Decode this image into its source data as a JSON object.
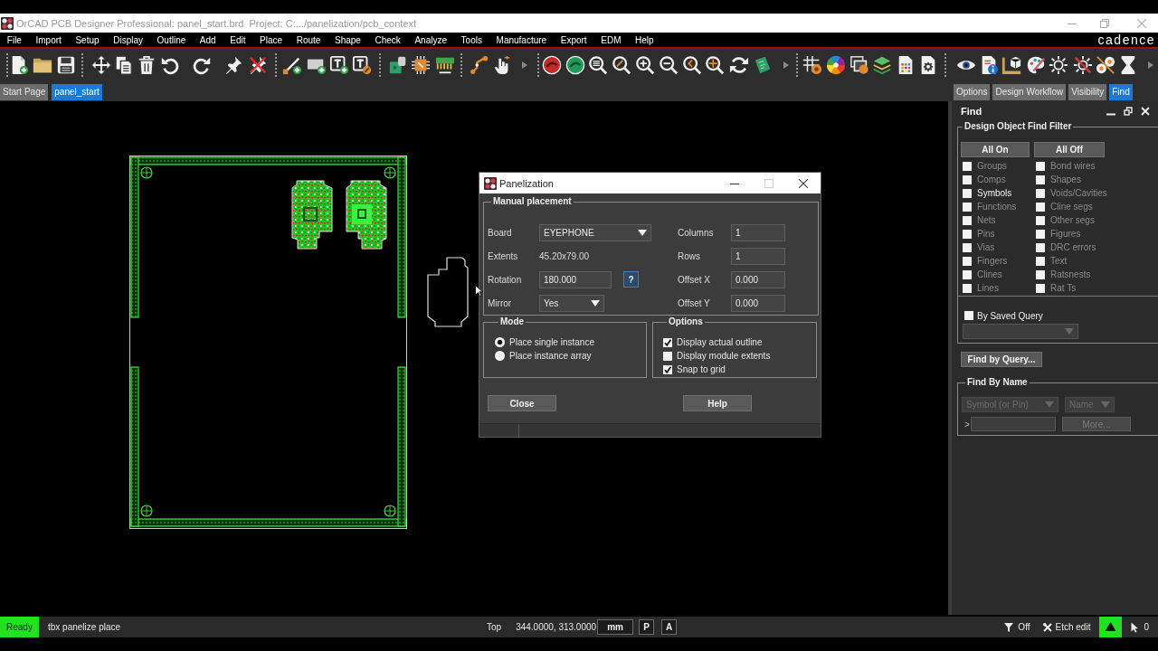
{
  "window": {
    "title": "OrCAD PCB Designer Professional: panel_start.brd  Project: C:.../panelization/pcb_context"
  },
  "menu_bar": {
    "items": [
      "File",
      "Import",
      "Setup",
      "Display",
      "Outline",
      "Add",
      "Edit",
      "Place",
      "Route",
      "Shape",
      "Check",
      "Analyze",
      "Tools",
      "Manufacture",
      "Export",
      "EDM",
      "Help"
    ],
    "logo": "cadence"
  },
  "document_tabs": [
    {
      "label": "Start Page",
      "selected": false
    },
    {
      "label": "panel_start",
      "selected": true
    }
  ],
  "panel_tabs": [
    {
      "label": "Options",
      "selected": false
    },
    {
      "label": "Design Workflow",
      "selected": false
    },
    {
      "label": "Visibility",
      "selected": false
    },
    {
      "label": "Find",
      "selected": true
    }
  ],
  "panelization_dialog": {
    "title": "Panelization",
    "manual_placement": {
      "title": "Manual placement",
      "rows": [
        {
          "left": {
            "label": "Board",
            "kind": "dropdown",
            "value": "EYEPHONE"
          },
          "right": {
            "label": "Columns",
            "kind": "input",
            "value": "1"
          }
        },
        {
          "left": {
            "label": "Extents",
            "kind": "readout",
            "value": "45.20x79.00"
          },
          "right": {
            "label": "Rows",
            "kind": "input",
            "value": "1"
          }
        },
        {
          "left": {
            "label": "Rotation",
            "kind": "input",
            "value": "180.000",
            "help_button": "?"
          },
          "right": {
            "label": "Offset X",
            "kind": "input",
            "value": "0.000"
          }
        },
        {
          "left": {
            "label": "Mirror",
            "kind": "dropdown",
            "value": "Yes"
          },
          "right": {
            "label": "Offset Y",
            "kind": "input",
            "value": "0.000"
          }
        }
      ]
    },
    "mode": {
      "title": "Mode",
      "options": [
        {
          "label": "Place single instance",
          "selected": true
        },
        {
          "label": "Place instance array",
          "selected": false
        }
      ]
    },
    "options": {
      "title": "Options",
      "items": [
        {
          "label": "Display actual outline",
          "checked": true
        },
        {
          "label": "Display module extents",
          "checked": false
        },
        {
          "label": "Snap to grid",
          "checked": true
        }
      ]
    },
    "buttons": [
      "Close",
      "Help"
    ]
  },
  "find_panel": {
    "title": "Find",
    "filter": {
      "title": "Design Object Find Filter",
      "buttons": [
        "All On",
        "All Off"
      ],
      "columns": [
        {
          "items": [
            {
              "label": "Groups",
              "checked": false,
              "disabled": true
            },
            {
              "label": "Comps",
              "checked": false,
              "disabled": true
            },
            {
              "label": "Symbols",
              "checked": false,
              "disabled": false
            },
            {
              "label": "Functions",
              "checked": false,
              "disabled": true
            },
            {
              "label": "Nets",
              "checked": false,
              "disabled": true
            },
            {
              "label": "Pins",
              "checked": false,
              "disabled": true
            },
            {
              "label": "Vias",
              "checked": false,
              "disabled": true
            },
            {
              "label": "Fingers",
              "checked": false,
              "disabled": true
            },
            {
              "label": "Clines",
              "checked": false,
              "disabled": true
            },
            {
              "label": "Lines",
              "checked": false,
              "disabled": true
            }
          ]
        },
        {
          "items": [
            {
              "label": "Bond wires",
              "checked": false,
              "disabled": true
            },
            {
              "label": "Shapes",
              "checked": false,
              "disabled": true
            },
            {
              "label": "Voids/Cavities",
              "checked": false,
              "disabled": true
            },
            {
              "label": "Cline segs",
              "checked": false,
              "disabled": true
            },
            {
              "label": "Other segs",
              "checked": false,
              "disabled": true
            },
            {
              "label": "Figures",
              "checked": false,
              "disabled": true
            },
            {
              "label": "DRC errors",
              "checked": false,
              "disabled": true
            },
            {
              "label": "Text",
              "checked": false,
              "disabled": true
            },
            {
              "label": "Ratsnests",
              "checked": false,
              "disabled": true
            },
            {
              "label": "Rat Ts",
              "checked": false,
              "disabled": true
            }
          ]
        }
      ],
      "saved_query": {
        "label": "By Saved Query",
        "checked": false
      }
    },
    "find_by_query_button": "Find by Query...",
    "find_by_name": {
      "title": "Find By Name",
      "object_type": {
        "value": "Symbol (or Pin)",
        "disabled": true
      },
      "match": {
        "value": "Name",
        "disabled": true
      },
      "prompt": ">",
      "more_button": {
        "label": "More...",
        "disabled": true
      }
    }
  },
  "status_bar": {
    "state": "Ready",
    "command": "tbx panelize place",
    "layer": "Top",
    "coordinates": "344.0000, 313.0000",
    "units": "mm",
    "toggles": [
      "P",
      "A"
    ],
    "filter": "Off",
    "mode": "Etch edit",
    "selection_count": "0"
  }
}
